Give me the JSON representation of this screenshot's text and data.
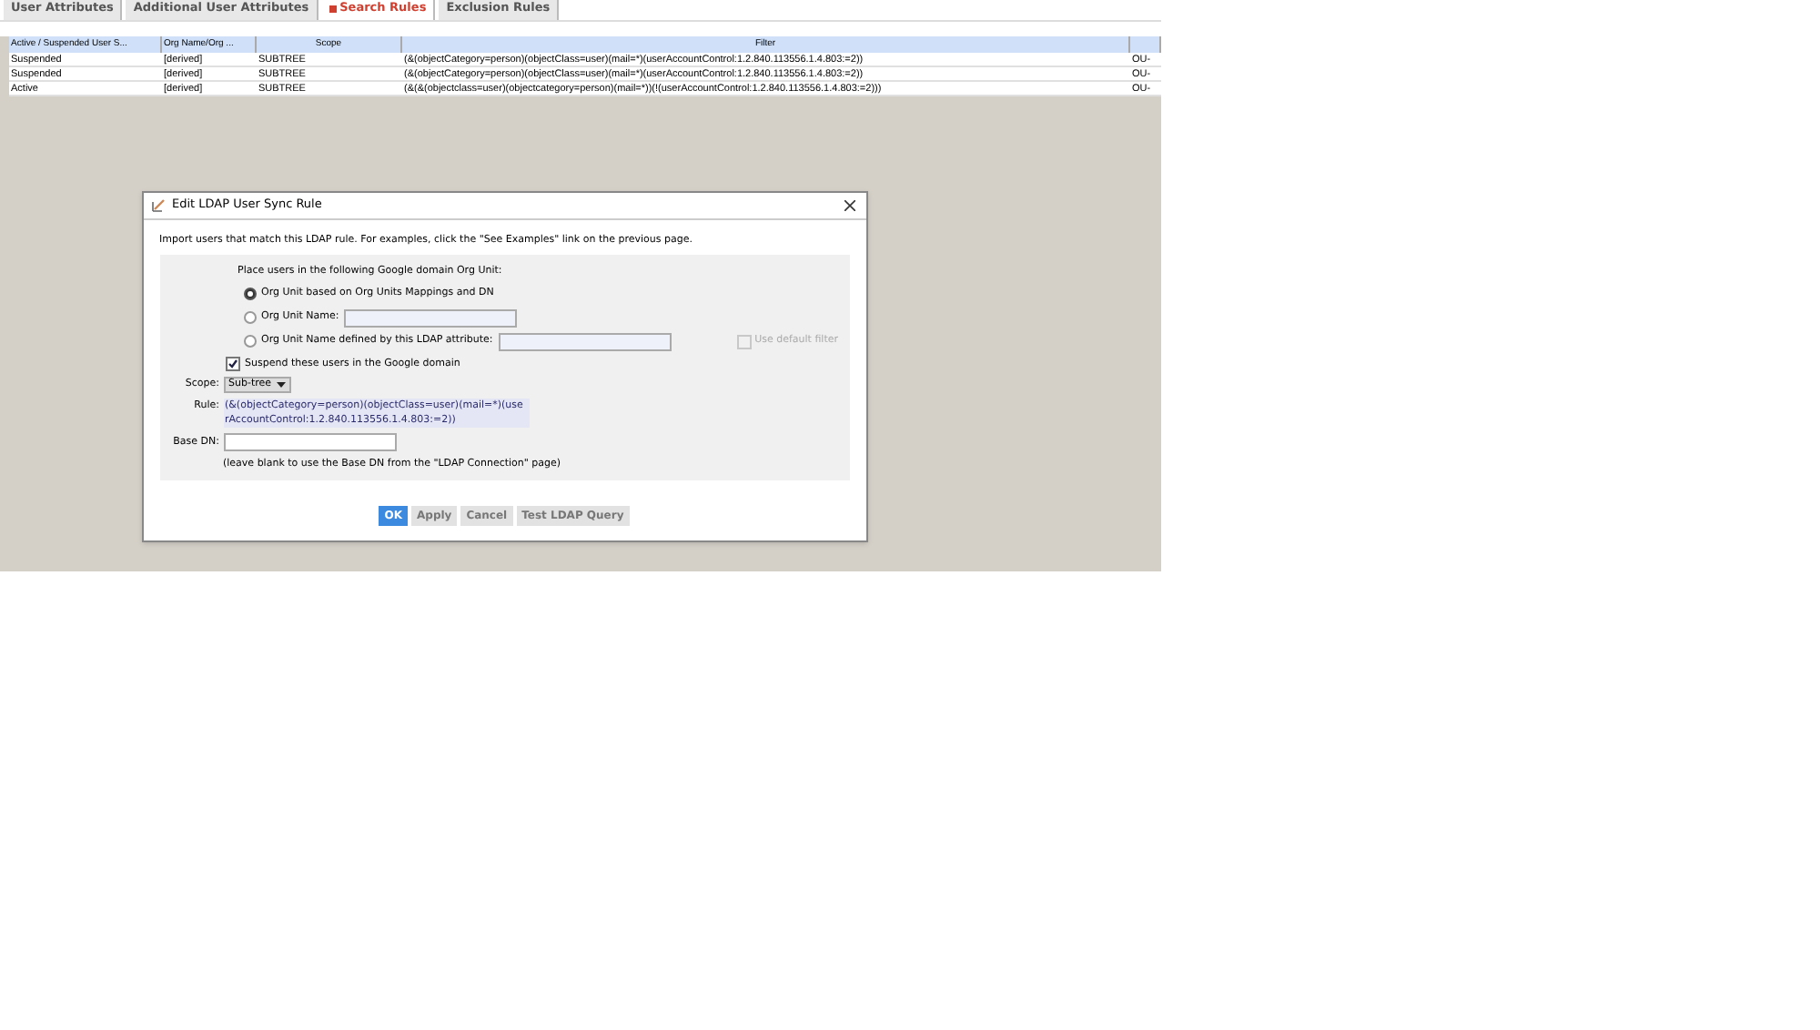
{
  "tabs": [
    {
      "label": "User Attributes",
      "selected": false
    },
    {
      "label": "Additional User Attributes",
      "selected": false
    },
    {
      "label": "Search Rules",
      "selected": true
    },
    {
      "label": "Exclusion Rules",
      "selected": false
    }
  ],
  "table": {
    "columns": [
      "Active / Suspended User S...",
      "Org Name/Org ...",
      "Scope",
      "Filter"
    ],
    "rows": [
      {
        "cells": [
          "Suspended",
          "[derived]",
          "SUBTREE",
          "(&(objectCategory=person)(objectClass=user)(mail=*)(userAccountControl:1.2.840.113556.1.4.803:=2))",
          "OU-"
        ]
      },
      {
        "cells": [
          "Suspended",
          "[derived]",
          "SUBTREE",
          "(&(objectCategory=person)(objectClass=user)(mail=*)(userAccountControl:1.2.840.113556.1.4.803:=2))",
          "OU-"
        ]
      },
      {
        "cells": [
          "Active",
          "[derived]",
          "SUBTREE",
          "(&(&(objectclass=user)(objectcategory=person)(mail=*))(!(userAccountControl:1.2.840.113556.1.4.803:=2)))",
          "OU-"
        ]
      }
    ]
  },
  "dialog": {
    "title": "Edit LDAP User Sync Rule",
    "intro": "Import users that match this LDAP rule.  For examples, click the \"See Examples\" link on the previous page.",
    "placement_label": "Place users in the following Google domain Org Unit:",
    "options": [
      {
        "label": "Org Unit based on Org Units Mappings and DN",
        "selected": true,
        "kind": "plain"
      },
      {
        "label": "Org Unit Name:",
        "selected": false,
        "kind": "field"
      },
      {
        "label": "Org Unit Name defined by this LDAP attribute:",
        "selected": false,
        "kind": "field"
      }
    ],
    "use_default_filter": {
      "label": "Use default filter",
      "checked": false,
      "disabled": true
    },
    "suspend": {
      "label": "Suspend these users in the Google domain",
      "checked": true
    },
    "scope": {
      "label": "Scope:",
      "value": "Sub-tree"
    },
    "rule": {
      "label": "Rule:",
      "value": "(&(objectCategory=person)(objectClass=user)(mail=*)(userAccountControl:1.2.840.113556.1.4.803:=2))"
    },
    "base_dn": {
      "label": "Base DN:",
      "hint": "(leave blank to use the Base DN from the \"LDAP Connection\" page)"
    },
    "buttons": [
      {
        "label": "OK",
        "primary": true
      },
      {
        "label": "Apply",
        "primary": false
      },
      {
        "label": "Cancel",
        "primary": false
      },
      {
        "label": "Test LDAP Query",
        "primary": false
      }
    ]
  }
}
